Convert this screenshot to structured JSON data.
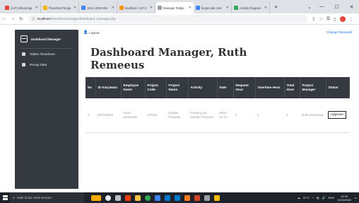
{
  "browser": {
    "tabs": [
      {
        "title": "(147) WhatsApp",
        "color": "#e8453c"
      },
      {
        "title": "Flowchart Penge",
        "color": "#f4b400"
      },
      {
        "title": "18.01.2018 Win",
        "color": "#4285f4"
      },
      {
        "title": "localhost / 127.0",
        "color": "#f29900"
      },
      {
        "title": "Manager Pedge",
        "color": "#9aa0a6",
        "active": true
      },
      {
        "title": "fungsi dan cont",
        "color": "#4285f4"
      },
      {
        "title": "Activity Diagram",
        "color": "#34a853"
      }
    ],
    "newtab": "+",
    "url_host": "localhost",
    "url_path": "/timesheet/manager/dashboard_manager.php"
  },
  "sidebar": {
    "brand": "Dashboard Manager",
    "items": [
      {
        "label": "Tables Timesheet"
      },
      {
        "label": "Recap Data"
      }
    ]
  },
  "header": {
    "logout": "LogOut",
    "change_password": "Change Password"
  },
  "main": {
    "title": "Dashboard Manager, Ruth Remeeus"
  },
  "table": {
    "columns": [
      "No",
      "ID Karyawan",
      "Employee Name",
      "Project Code",
      "Project Name",
      "Activity",
      "Date",
      "Request Hour",
      "Overtime Hour",
      "Total Hour",
      "Project Manager",
      "Status"
    ],
    "rows": [
      {
        "no": "1",
        "id": "KRYWN01",
        "employee": "Kevin Alexander",
        "project_code": "UPD01",
        "project_name": "Update Program",
        "activity": "Creating an Update Program",
        "date": "2022-12-14",
        "request_hour": "3",
        "overtime_hour": "1",
        "total_hour": "4",
        "project_manager": "Ruth Remeeus",
        "status_button": "Approve"
      }
    ]
  },
  "taskbar": {
    "search_placeholder": "Ketik di sini untuk mencari",
    "weather": "31°C",
    "lang": "ENG",
    "time": "16:29",
    "date": "13/12/2022"
  },
  "colors": {
    "sidebar_bg": "#343a40",
    "table_header_bg": "#343a40",
    "link": "#1a73e8"
  }
}
